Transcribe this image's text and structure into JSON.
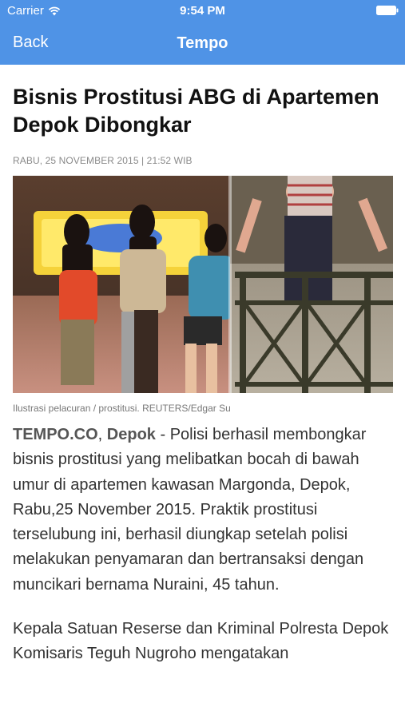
{
  "status_bar": {
    "carrier": "Carrier",
    "time": "9:54 PM",
    "icons": [
      "wifi-icon",
      "battery-icon"
    ]
  },
  "nav": {
    "back_label": "Back",
    "title": "Tempo",
    "background_color": "#4f93e6"
  },
  "article": {
    "headline": "Bisnis Prostitusi ABG di Apartemen Depok Dibongkar",
    "date": "RABU, 25 NOVEMBER 2015 | 21:52 WIB",
    "photo_caption": "Ilustrasi pelacuran / prostitusi. REUTERS/Edgar Su",
    "lead": {
      "source": "TEMPO.CO",
      "separator": ", ",
      "location": "Depok",
      "dash": " - ",
      "text": "Polisi berhasil membongkar bisnis prostitusi yang melibatkan bocah di bawah umur di apartemen kawasan Margonda, Depok, Rabu,25 November 2015. Praktik prostitusi terselubung ini, berhasil diungkap setelah polisi melakukan penyamaran dan bertransaksi dengan muncikari bernama Nuraini, 45 tahun."
    },
    "paragraph_2": "Kepala Satuan Reserse dan Kriminal Polresta Depok Komisaris Teguh Nugroho mengatakan"
  }
}
